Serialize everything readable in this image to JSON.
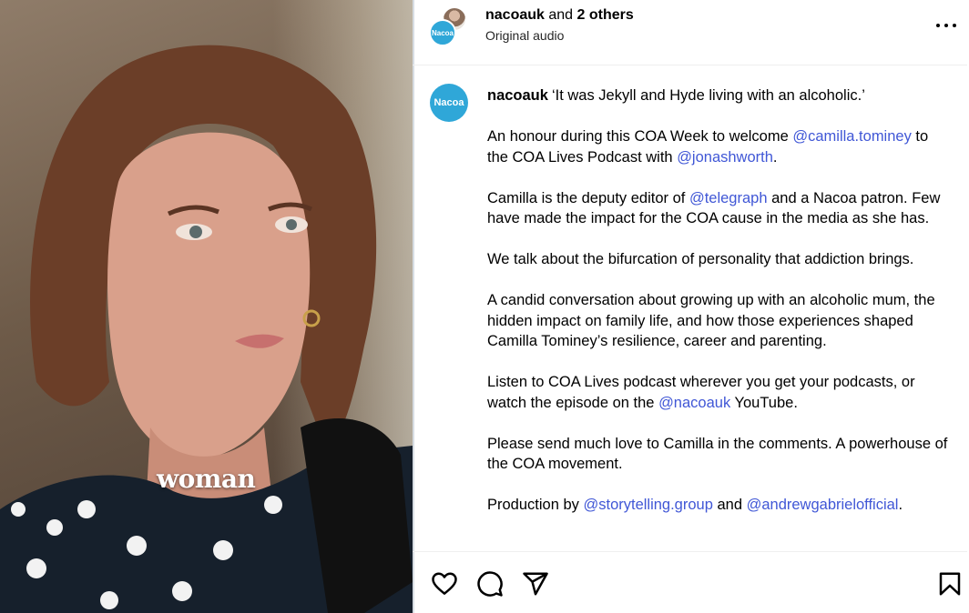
{
  "media": {
    "caption_overlay": "woman"
  },
  "header": {
    "username": "nacoauk",
    "joiner": "and",
    "others": "2 others",
    "audio": "Original audio",
    "avatar_logo_text": "Nacoa"
  },
  "post": {
    "avatar_logo_text": "Nacoa",
    "username": "nacoauk",
    "p1_text": "‘It was Jekyll and Hyde living with an alcoholic.’",
    "p2_a": "An honour during this COA Week to welcome ",
    "p2_m1": "@camilla.tominey",
    "p2_b": " to the COA Lives Podcast with ",
    "p2_m2": "@jonashworth",
    "p2_c": ".",
    "p3_a": "Camilla is the deputy editor of ",
    "p3_m1": "@telegraph",
    "p3_b": " and a Nacoa patron. Few have made the impact for the COA cause in the media as she has.",
    "p4": "We talk about the bifurcation of personality that addiction brings.",
    "p5": "A candid conversation about growing up with an alcoholic mum, the hidden impact on family life, and how those experiences shaped Camilla Tominey’s resilience, career and parenting.",
    "p6_a": "Listen to COA Lives podcast wherever you get your podcasts, or watch the episode on the ",
    "p6_m1": "@nacoauk",
    "p6_b": " YouTube.",
    "p7": "Please send much love to Camilla in the comments. A powerhouse of the COA movement.",
    "p8_a": "Production by ",
    "p8_m1": "@storytelling.group",
    "p8_b": " and ",
    "p8_m2": "@andrewgabrielofficial",
    "p8_c": "."
  },
  "icons": {
    "like": "heart-icon",
    "comment": "comment-icon",
    "share": "share-icon",
    "save": "bookmark-icon",
    "more": "more-icon"
  }
}
